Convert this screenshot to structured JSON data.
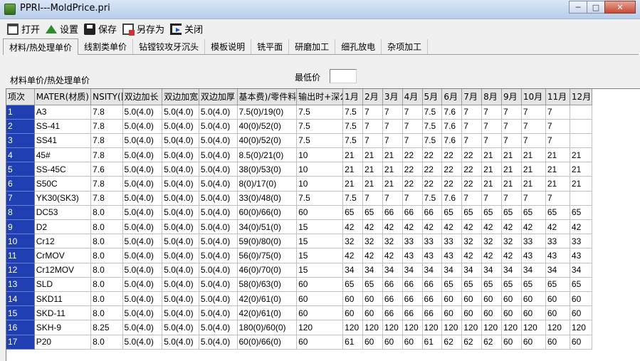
{
  "window": {
    "title": "PPRI---MoldPrice.pri",
    "min": "─",
    "max": "□",
    "close": "✕"
  },
  "toolbar": {
    "open": "打开",
    "settings": "设置",
    "save": "保存",
    "save_as": "另存为",
    "close": "关闭"
  },
  "tabs": [
    "材料/热处理单价",
    "线割类单价",
    "钻镗铰攻牙沉头",
    "模板说明",
    "铣平面",
    "研磨加工",
    "细孔放电",
    "杂项加工"
  ],
  "section_label": "材料单价/热处理单价",
  "min_price_label": "最低价",
  "min_price_value": "",
  "table": {
    "headers": [
      "项次",
      "MATER(材质)",
      "NSITY(比",
      "双边加长",
      "双边加宽",
      "双边加厚",
      "基本费)/零件料",
      "输出时+深公",
      "1月",
      "2月",
      "3月",
      "4月",
      "5月",
      "6月",
      "7月",
      "8月",
      "9月",
      "10月",
      "11月",
      "12月"
    ],
    "rows": [
      [
        "1",
        "A3",
        "7.8",
        "5.0(4.0)",
        "5.0(4.0)",
        "5.0(4.0)",
        "7.5(0)/19(0)",
        "7.5",
        "7.5",
        "7",
        "7",
        "7",
        "7.5",
        "7.6",
        "7",
        "7",
        "7",
        "7",
        "7",
        ""
      ],
      [
        "2",
        "SS-41",
        "7.8",
        "5.0(4.0)",
        "5.0(4.0)",
        "5.0(4.0)",
        "40(0)/52(0)",
        "7.5",
        "7.5",
        "7",
        "7",
        "7",
        "7.5",
        "7.6",
        "7",
        "7",
        "7",
        "7",
        "7",
        ""
      ],
      [
        "3",
        "SS41",
        "7.8",
        "5.0(4.0)",
        "5.0(4.0)",
        "5.0(4.0)",
        "40(0)/52(0)",
        "7.5",
        "7.5",
        "7",
        "7",
        "7",
        "7.5",
        "7.6",
        "7",
        "7",
        "7",
        "7",
        "7",
        ""
      ],
      [
        "4",
        "45#",
        "7.8",
        "5.0(4.0)",
        "5.0(4.0)",
        "5.0(4.0)",
        "8.5(0)/21(0)",
        "10",
        "21",
        "21",
        "21",
        "22",
        "22",
        "22",
        "22",
        "21",
        "21",
        "21",
        "21",
        "21"
      ],
      [
        "5",
        "SS-45C",
        "7.6",
        "5.0(4.0)",
        "5.0(4.0)",
        "5.0(4.0)",
        "38(0)/53(0)",
        "10",
        "21",
        "21",
        "21",
        "22",
        "22",
        "22",
        "22",
        "21",
        "21",
        "21",
        "21",
        "21"
      ],
      [
        "6",
        "S50C",
        "7.8",
        "5.0(4.0)",
        "5.0(4.0)",
        "5.0(4.0)",
        "8(0)/17(0)",
        "10",
        "21",
        "21",
        "21",
        "22",
        "22",
        "22",
        "22",
        "21",
        "21",
        "21",
        "21",
        "21"
      ],
      [
        "7",
        "YK30(SK3)",
        "7.8",
        "5.0(4.0)",
        "5.0(4.0)",
        "5.0(4.0)",
        "33(0)/48(0)",
        "7.5",
        "7.5",
        "7",
        "7",
        "7",
        "7.5",
        "7.6",
        "7",
        "7",
        "7",
        "7",
        "7",
        ""
      ],
      [
        "8",
        "DC53",
        "8.0",
        "5.0(4.0)",
        "5.0(4.0)",
        "5.0(4.0)",
        "60(0)/66(0)",
        "60",
        "65",
        "65",
        "66",
        "66",
        "66",
        "65",
        "65",
        "65",
        "65",
        "65",
        "65",
        "65"
      ],
      [
        "9",
        "D2",
        "8.0",
        "5.0(4.0)",
        "5.0(4.0)",
        "5.0(4.0)",
        "34(0)/51(0)",
        "15",
        "42",
        "42",
        "42",
        "42",
        "42",
        "42",
        "42",
        "42",
        "42",
        "42",
        "42",
        "42"
      ],
      [
        "10",
        "Cr12",
        "8.0",
        "5.0(4.0)",
        "5.0(4.0)",
        "5.0(4.0)",
        "59(0)/80(0)",
        "15",
        "32",
        "32",
        "32",
        "33",
        "33",
        "33",
        "32",
        "32",
        "32",
        "33",
        "33",
        "33"
      ],
      [
        "11",
        "CrMOV",
        "8.0",
        "5.0(4.0)",
        "5.0(4.0)",
        "5.0(4.0)",
        "56(0)/75(0)",
        "15",
        "42",
        "42",
        "42",
        "43",
        "43",
        "43",
        "42",
        "42",
        "42",
        "43",
        "43",
        "43"
      ],
      [
        "12",
        "Cr12MOV",
        "8.0",
        "5.0(4.0)",
        "5.0(4.0)",
        "5.0(4.0)",
        "46(0)/70(0)",
        "15",
        "34",
        "34",
        "34",
        "34",
        "34",
        "34",
        "34",
        "34",
        "34",
        "34",
        "34",
        "34"
      ],
      [
        "13",
        "SLD",
        "8.0",
        "5.0(4.0)",
        "5.0(4.0)",
        "5.0(4.0)",
        "58(0)/63(0)",
        "60",
        "65",
        "65",
        "66",
        "66",
        "66",
        "65",
        "65",
        "65",
        "65",
        "65",
        "65",
        "65"
      ],
      [
        "14",
        "SKD11",
        "8.0",
        "5.0(4.0)",
        "5.0(4.0)",
        "5.0(4.0)",
        "42(0)/61(0)",
        "60",
        "60",
        "60",
        "66",
        "66",
        "66",
        "60",
        "60",
        "60",
        "60",
        "60",
        "60",
        "60"
      ],
      [
        "15",
        "SKD-11",
        "8.0",
        "5.0(4.0)",
        "5.0(4.0)",
        "5.0(4.0)",
        "42(0)/61(0)",
        "60",
        "60",
        "60",
        "66",
        "66",
        "66",
        "60",
        "60",
        "60",
        "60",
        "60",
        "60",
        "60"
      ],
      [
        "16",
        "SKH-9",
        "8.25",
        "5.0(4.0)",
        "5.0(4.0)",
        "5.0(4.0)",
        "180(0)/60(0)",
        "120",
        "120",
        "120",
        "120",
        "120",
        "120",
        "120",
        "120",
        "120",
        "120",
        "120",
        "120",
        "120"
      ],
      [
        "17",
        "P20",
        "8.0",
        "5.0(4.0)",
        "5.0(4.0)",
        "5.0(4.0)",
        "60(0)/66(0)",
        "60",
        "61",
        "60",
        "60",
        "60",
        "61",
        "62",
        "62",
        "62",
        "60",
        "60",
        "60",
        "60"
      ]
    ]
  }
}
